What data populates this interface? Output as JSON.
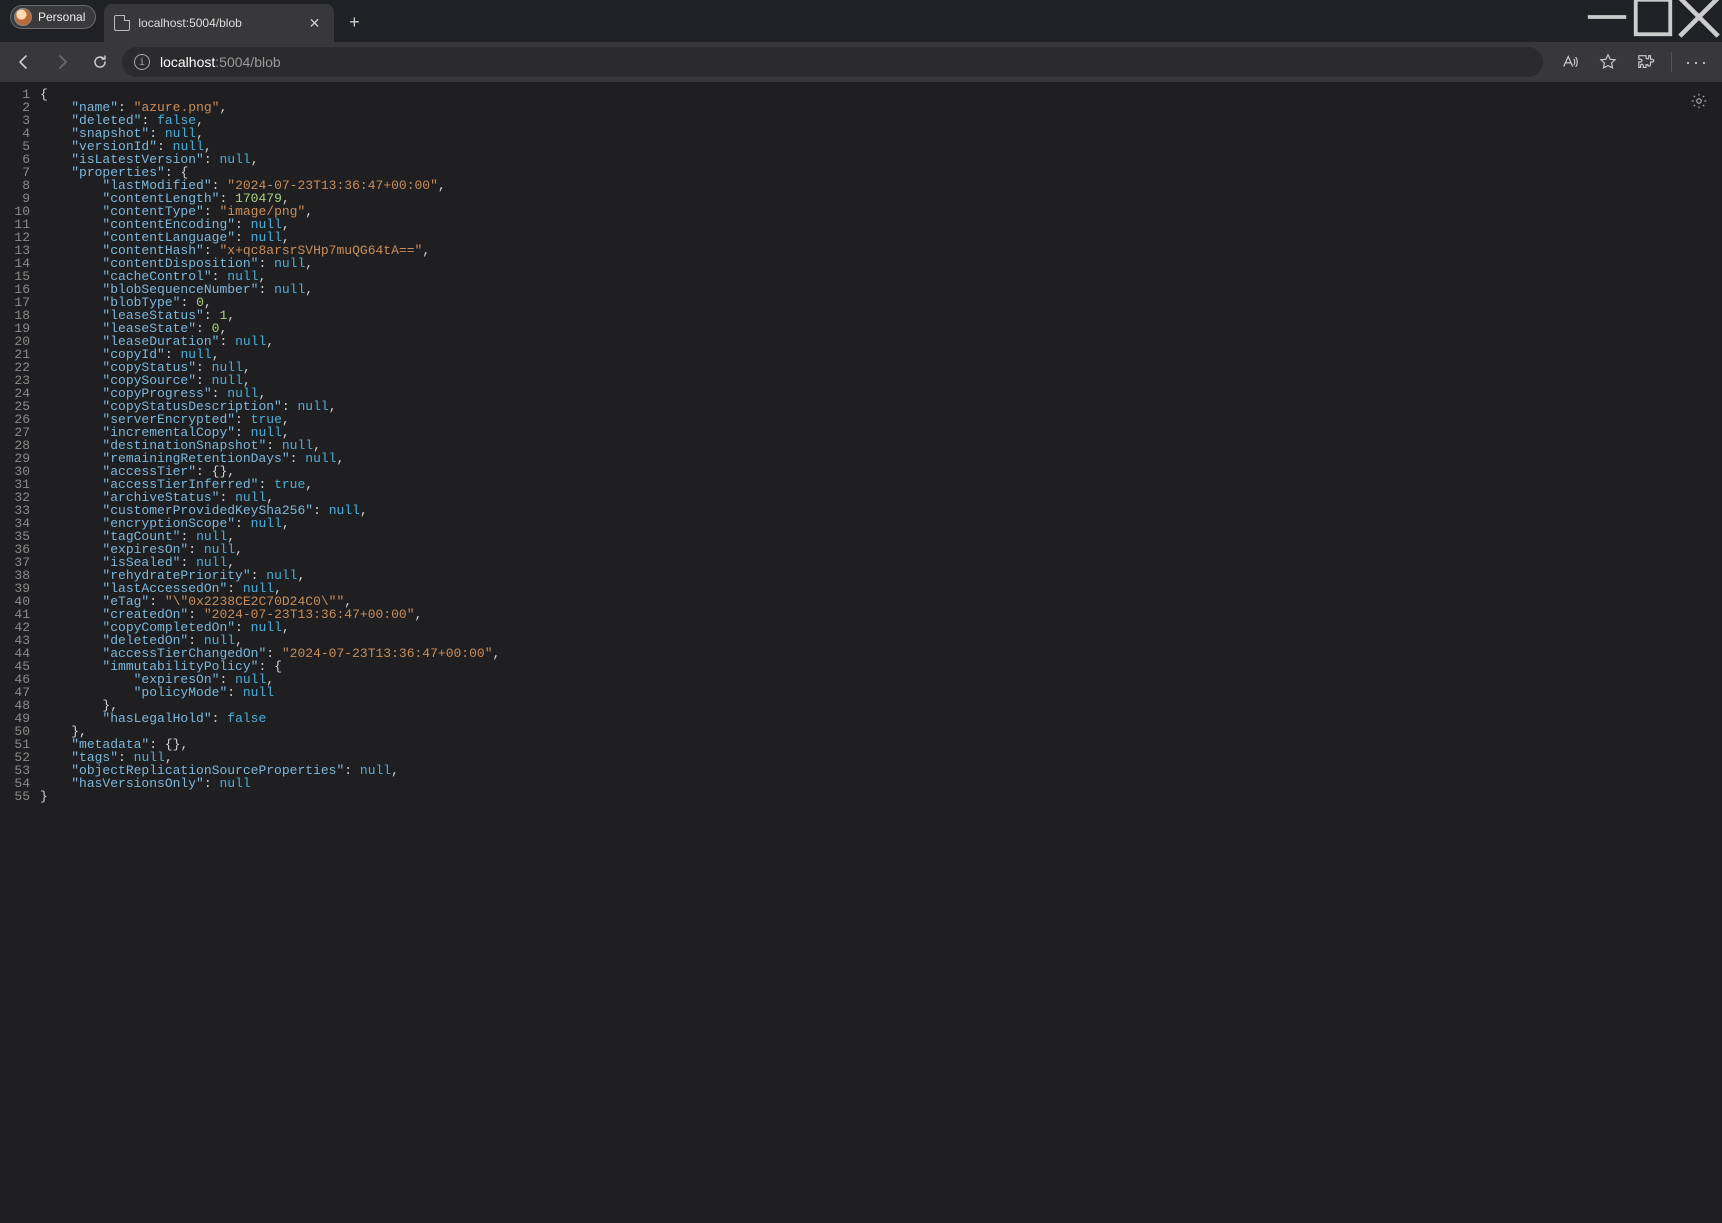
{
  "titlebar": {
    "profile_label": "Personal",
    "tab_title": "localhost:5004/blob"
  },
  "toolbar": {
    "url_host": "localhost",
    "url_path": ":5004/blob"
  },
  "json_body": {
    "name": "azure.png",
    "deleted": false,
    "snapshot": null,
    "versionId": null,
    "isLatestVersion": null,
    "properties": {
      "lastModified": "2024-07-23T13:36:47+00:00",
      "contentLength": 170479,
      "contentType": "image/png",
      "contentEncoding": null,
      "contentLanguage": null,
      "contentHash": "x+qc8arsrSVHp7muQG64tA==",
      "contentDisposition": null,
      "cacheControl": null,
      "blobSequenceNumber": null,
      "blobType": 0,
      "leaseStatus": 1,
      "leaseState": 0,
      "leaseDuration": null,
      "copyId": null,
      "copyStatus": null,
      "copySource": null,
      "copyProgress": null,
      "copyStatusDescription": null,
      "serverEncrypted": true,
      "incrementalCopy": null,
      "destinationSnapshot": null,
      "remainingRetentionDays": null,
      "accessTier": {},
      "accessTierInferred": true,
      "archiveStatus": null,
      "customerProvidedKeySha256": null,
      "encryptionScope": null,
      "tagCount": null,
      "expiresOn": null,
      "isSealed": null,
      "rehydratePriority": null,
      "lastAccessedOn": null,
      "eTag": "\\\"0x2238CE2C70D24C0\\\"",
      "createdOn": "2024-07-23T13:36:47+00:00",
      "copyCompletedOn": null,
      "deletedOn": null,
      "accessTierChangedOn": "2024-07-23T13:36:47+00:00",
      "immutabilityPolicy": {
        "expiresOn": null,
        "policyMode": null
      },
      "hasLegalHold": false
    },
    "metadata": {},
    "tags": null,
    "objectReplicationSourceProperties": null,
    "hasVersionsOnly": null
  },
  "line_count": 55
}
